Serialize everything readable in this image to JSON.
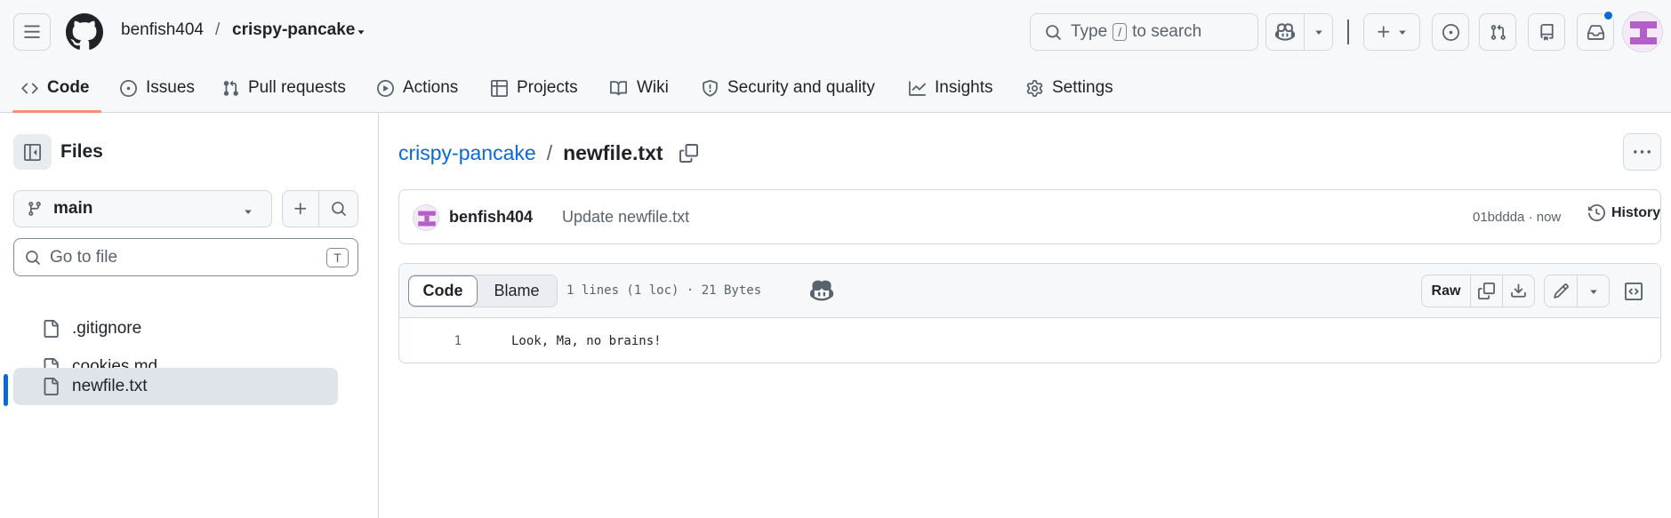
{
  "header": {
    "owner": "benfish404",
    "separator": "/",
    "repo": "crispy-pancake",
    "search": {
      "prefix": "Type",
      "key": "/",
      "suffix": "to search"
    }
  },
  "repo_nav": {
    "items": [
      {
        "label": "Code",
        "icon": "code-icon",
        "active": true
      },
      {
        "label": "Issues",
        "icon": "issue-icon"
      },
      {
        "label": "Pull requests",
        "icon": "pull-request-icon"
      },
      {
        "label": "Actions",
        "icon": "play-icon"
      },
      {
        "label": "Projects",
        "icon": "table-icon"
      },
      {
        "label": "Wiki",
        "icon": "book-icon"
      },
      {
        "label": "Security and quality",
        "icon": "shield-icon"
      },
      {
        "label": "Insights",
        "icon": "graph-icon"
      },
      {
        "label": "Settings",
        "icon": "gear-icon"
      }
    ]
  },
  "sidebar": {
    "title": "Files",
    "branch": "main",
    "goto_placeholder": "Go to file",
    "goto_key": "T",
    "files": [
      {
        "name": ".gitignore",
        "selected": false
      },
      {
        "name": "cookies.md",
        "selected": false
      },
      {
        "name": "newfile.txt",
        "selected": true
      }
    ]
  },
  "main": {
    "breadcrumb": {
      "repo": "crispy-pancake",
      "separator": "/",
      "file": "newfile.txt"
    },
    "commit": {
      "author": "benfish404",
      "message": "Update newfile.txt",
      "meta": "01bddda · now",
      "history_label": "History"
    },
    "file": {
      "tabs": {
        "code": "Code",
        "blame": "Blame"
      },
      "stats": "1 lines (1 loc) · 21 Bytes",
      "raw_label": "Raw",
      "lines": [
        {
          "num": "1",
          "text": "Look, Ma, no brains!"
        }
      ]
    }
  },
  "colors": {
    "accent": "#0969da",
    "nav_underline": "#fd8c73",
    "avatar_purple": "#b45ec7"
  }
}
